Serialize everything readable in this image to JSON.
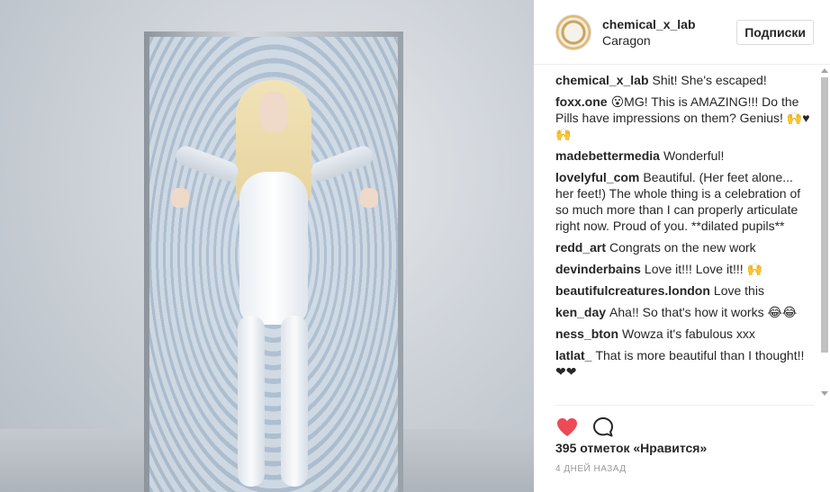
{
  "post": {
    "username": "chemical_x_lab",
    "location": "Caragon",
    "follow_label": "Подписки"
  },
  "comments": [
    {
      "user": "chemical_x_lab",
      "text": "Shit! She's escaped!"
    },
    {
      "user": "foxx.one",
      "text": "😮MG! This is AMAZING!!! Do the Pills have impressions on them? Genius! 🙌♥ 🙌"
    },
    {
      "user": "madebettermedia",
      "text": "Wonderful!"
    },
    {
      "user": "lovelyful_com",
      "text": "Beautiful. (Her feet alone... her feet!) The whole thing is a celebration of so much more than I can properly articulate right now. Proud of you. **dilated pupils**"
    },
    {
      "user": "redd_art",
      "text": "Congrats on the new work"
    },
    {
      "user": "devinderbains",
      "text": "Love it!!! Love it!!! 🙌"
    },
    {
      "user": "beautifulcreatures.london",
      "text": "Love this"
    },
    {
      "user": "ken_day",
      "text": "Aha!! So that's how it works 😂😂"
    },
    {
      "user": "ness_bton",
      "text": "Wowza it's fabulous xxx"
    },
    {
      "user": "latlat_",
      "text": "That is more beautiful than I thought!!❤❤"
    }
  ],
  "likes_text": "395 отметок «Нравится»",
  "time_text": "4 дней назад",
  "icons": {
    "like": "heart-icon",
    "comment": "comment-icon"
  },
  "colors": {
    "like_red": "#ed4956",
    "text": "#262626",
    "muted": "#999999"
  }
}
